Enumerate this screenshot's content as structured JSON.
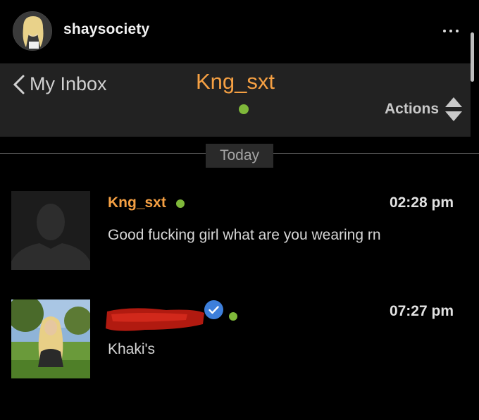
{
  "header": {
    "username": "shaysociety",
    "more_icon": "more-dots-icon"
  },
  "inbox_bar": {
    "back_label": "My Inbox",
    "chat_title": "Kng_sxt",
    "actions_label": "Actions"
  },
  "separator": {
    "date_label": "Today"
  },
  "messages": [
    {
      "sender": "Kng_sxt",
      "time": "02:28 pm",
      "text": "Good fucking girl what are you wearing rn",
      "online": true
    },
    {
      "sender": "",
      "time": "07:27 pm",
      "text": "Khaki's",
      "online": true,
      "verified": true,
      "name_redacted": true
    }
  ],
  "colors": {
    "accent": "#f5a043",
    "online": "#7fb83a",
    "verified": "#3d7fdb",
    "background": "#000000",
    "bar": "#222222"
  }
}
